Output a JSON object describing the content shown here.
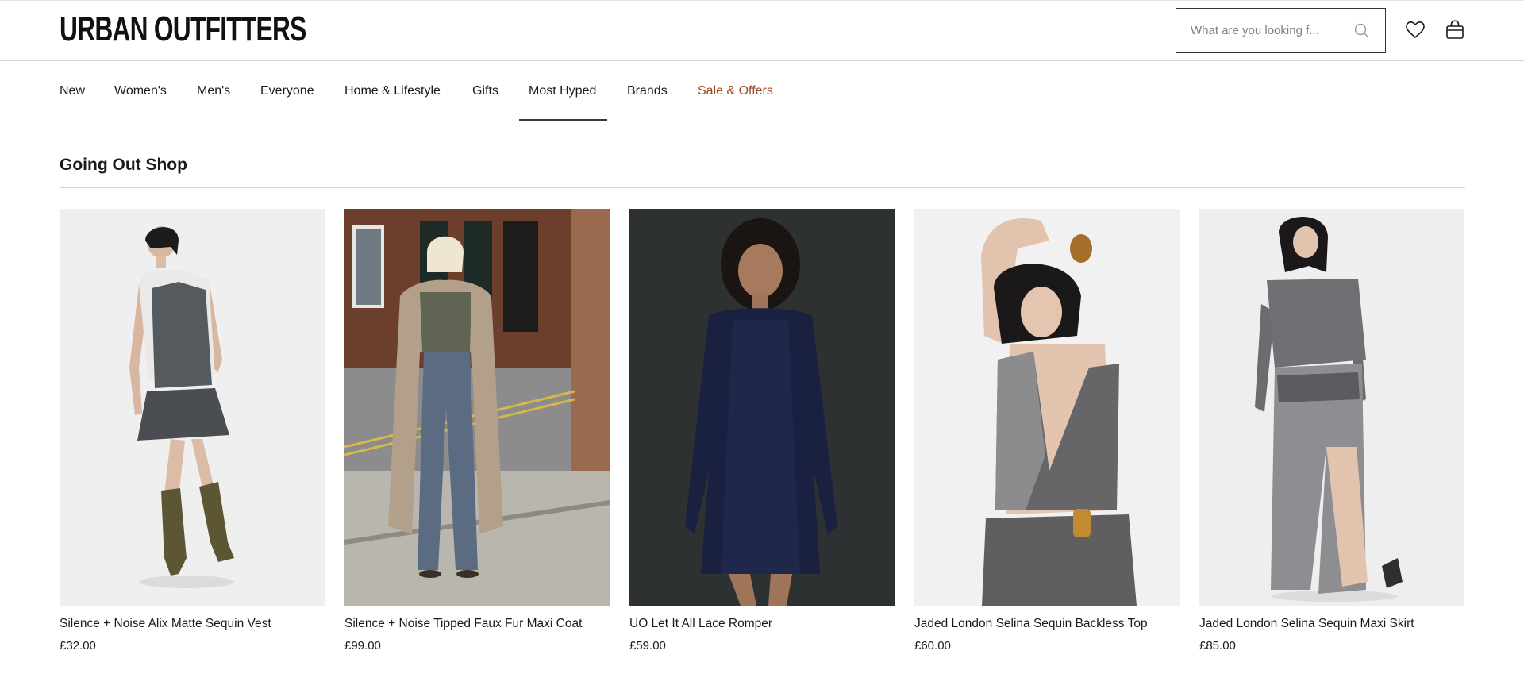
{
  "header": {
    "logo": "URBAN OUTFITTERS",
    "search_placeholder": "What are you looking f...",
    "icons": [
      "search-icon",
      "heart-icon",
      "bag-icon"
    ]
  },
  "nav": {
    "items": [
      {
        "label": "New"
      },
      {
        "label": "Women's"
      },
      {
        "label": "Men's"
      },
      {
        "label": "Everyone"
      },
      {
        "label": "Home & Lifestyle"
      },
      {
        "label": "Gifts"
      },
      {
        "label": "Most Hyped"
      },
      {
        "label": "Brands"
      },
      {
        "label": "Sale & Offers"
      }
    ],
    "active": "Most Hyped"
  },
  "section": {
    "title": "Going Out Shop"
  },
  "products": [
    {
      "name": "Silence + Noise Alix Matte Sequin Vest",
      "price": "£32.00"
    },
    {
      "name": "Silence + Noise Tipped Faux Fur Maxi Coat",
      "price": "£99.00"
    },
    {
      "name": "UO Let It All Lace Romper",
      "price": "£59.00"
    },
    {
      "name": "Jaded London Selina Sequin Backless Top",
      "price": "£60.00"
    },
    {
      "name": "Jaded London Selina Sequin Maxi Skirt",
      "price": "£85.00"
    }
  ],
  "colors": {
    "sale_accent": "#9a4a1e",
    "text": "#1a1a1a",
    "divider": "#d9d9d9"
  }
}
